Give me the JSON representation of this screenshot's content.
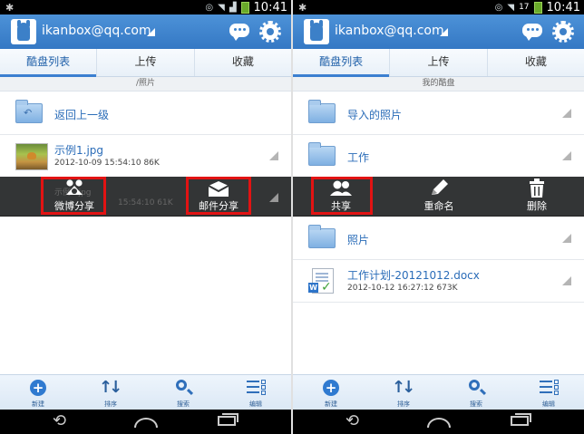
{
  "status": {
    "time": "10:41",
    "right_screen_badge": "17"
  },
  "header": {
    "account": "ikanbox@qq.com"
  },
  "tabs": [
    "酷盘列表",
    "上传",
    "收藏"
  ],
  "left": {
    "path": "/照片",
    "back_label": "返回上一级",
    "file": {
      "name": "示例1.jpg",
      "meta": "2012-10-09 15:54:10 86K"
    },
    "ghost_name": "示例2.jpg",
    "ghost_meta": "15:54:10 61K",
    "actions": [
      {
        "label": "微博分享",
        "icon": "weibo-share-icon"
      },
      {
        "label": "邮件分享",
        "icon": "mail-share-icon"
      }
    ]
  },
  "right": {
    "path": "我的酷盘",
    "folders": [
      "导入的照片",
      "工作",
      "照片"
    ],
    "actions": [
      {
        "label": "共享",
        "icon": "share-users-icon"
      },
      {
        "label": "重命名",
        "icon": "pen-icon"
      },
      {
        "label": "删除",
        "icon": "trash-icon"
      }
    ],
    "doc": {
      "name": "工作计划-20121012.docx",
      "meta": "2012-10-12 16:27:12 673K"
    }
  },
  "toolbar": [
    "新建",
    "排序",
    "搜索",
    "编辑"
  ],
  "colors": {
    "accent": "#3b7fd0",
    "highlight": "#e21313",
    "actionbar": "#333536"
  }
}
